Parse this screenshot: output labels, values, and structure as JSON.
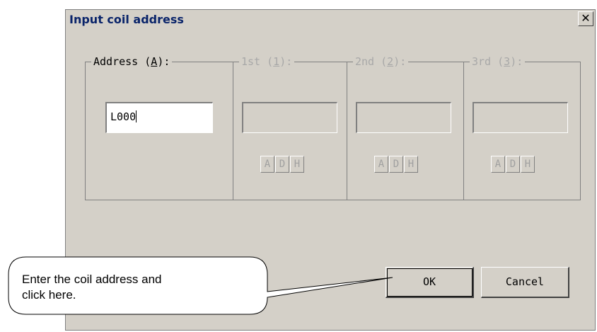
{
  "dialog": {
    "title": "Input coil address",
    "close_glyph": "✕"
  },
  "groups": [
    {
      "label_pre": "Address (",
      "label_key": "A",
      "label_post": "):",
      "value": "L000",
      "enabled": true
    },
    {
      "label_pre": "1st (",
      "label_key": "1",
      "label_post": "):",
      "enabled": false,
      "buttons": [
        "A",
        "D",
        "H"
      ]
    },
    {
      "label_pre": "2nd (",
      "label_key": "2",
      "label_post": "):",
      "enabled": false,
      "buttons": [
        "A",
        "D",
        "H"
      ]
    },
    {
      "label_pre": "3rd (",
      "label_key": "3",
      "label_post": "):",
      "enabled": false,
      "buttons": [
        "A",
        "D",
        "H"
      ]
    }
  ],
  "buttons": {
    "ok": "OK",
    "cancel": "Cancel"
  },
  "callout": {
    "line1": "Enter the coil address and",
    "line2": "click here."
  },
  "colors": {
    "dialog_bg": "#d4d0c8",
    "title_text": "#0a246a",
    "disabled_text": "#a8a8a8"
  },
  "icons": {
    "close": "close-icon"
  }
}
